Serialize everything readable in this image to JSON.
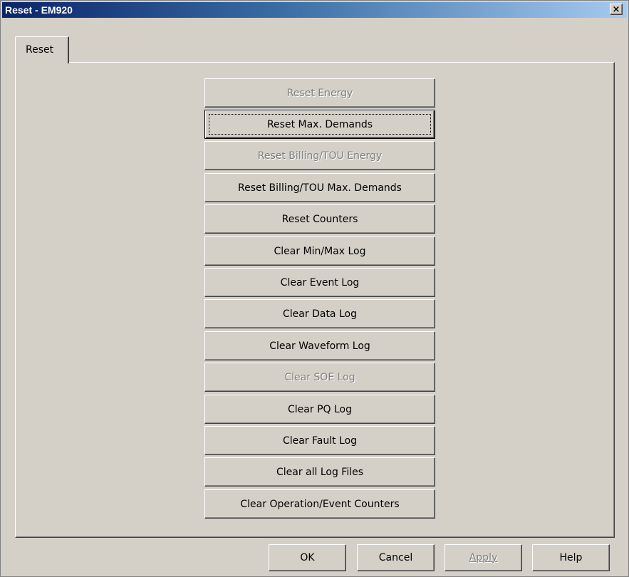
{
  "window": {
    "title": "Reset - EM920",
    "close_label": "×"
  },
  "tabs": [
    {
      "label": "Reset"
    }
  ],
  "reset_buttons": [
    {
      "label": "Reset Energy",
      "enabled": false
    },
    {
      "label": "Reset Max. Demands",
      "enabled": true,
      "focused": true
    },
    {
      "label": "Reset Billing/TOU Energy",
      "enabled": false
    },
    {
      "label": "Reset Billing/TOU Max. Demands",
      "enabled": true
    },
    {
      "label": "Reset Counters",
      "enabled": true
    },
    {
      "label": "Clear Min/Max Log",
      "enabled": true
    },
    {
      "label": "Clear Event Log",
      "enabled": true
    },
    {
      "label": "Clear Data Log",
      "enabled": true
    },
    {
      "label": "Clear Waveform Log",
      "enabled": true
    },
    {
      "label": "Clear SOE Log",
      "enabled": false
    },
    {
      "label": "Clear PQ Log",
      "enabled": true
    },
    {
      "label": "Clear Fault Log",
      "enabled": true
    },
    {
      "label": "Clear all Log Files",
      "enabled": true
    },
    {
      "label": "Clear Operation/Event Counters",
      "enabled": true
    }
  ],
  "footer": {
    "ok_label": "OK",
    "cancel_label": "Cancel",
    "apply_label": "Apply",
    "help_label": "Help",
    "apply_enabled": false
  }
}
